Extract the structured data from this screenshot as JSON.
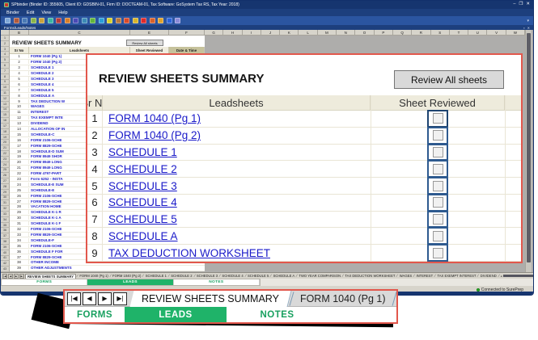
{
  "window": {
    "title": "SPbinder (Binder ID: 355605, Client ID: GDSBIN-01, Firm ID: DOCTEAM-01, Tax Software: GoSystem Tax RS, Tax Year: 2018)",
    "controls": [
      "–",
      "❐",
      "✕"
    ],
    "menu": [
      "Binder",
      "Edit",
      "View",
      "Help"
    ],
    "panel_title": "Forms/Leads/Notes",
    "panel_icons": [
      "▪",
      "✕"
    ],
    "status_text": "Connected to SurePrep"
  },
  "toolbar_icon_colors": [
    "#7ea7d8",
    "#b05a3c",
    "#4a7ab5",
    "#8ab54a",
    "#c8a23c",
    "#3cb5a0",
    "#b53c3c",
    "#d87e2a",
    "#4a4ab5",
    "#3c8ab5",
    "#62b53c",
    "#2a9ed8",
    "#d8d02a",
    "#b5763c",
    "#d84a2a",
    "#d8b42a",
    "#e02a2a",
    "#d8622a",
    "#e0a22a",
    "#2a62d8",
    "#8a8ad8"
  ],
  "spreadsheet": {
    "column_letters": [
      "B",
      "C",
      "E",
      "F",
      "G",
      "H",
      "I",
      "J",
      "K",
      "L",
      "M",
      "N",
      "O",
      "P",
      "Q",
      "R",
      "S",
      "T",
      "U",
      "V",
      "W"
    ],
    "gutter_count": 43,
    "title": "REVIEW SHEETS SUMMARY",
    "review_all_button": "Review All sheets",
    "headers": {
      "sr": "Sr No",
      "lead": "Leadsheets",
      "reviewed": "Sheet Reviewed",
      "datetime": "Date & Time"
    },
    "rows": [
      {
        "no": "1",
        "label": "FORM 1040 (Pg 1)"
      },
      {
        "no": "2",
        "label": "FORM 1040 (Pg 2)"
      },
      {
        "no": "3",
        "label": "SCHEDULE 1"
      },
      {
        "no": "4",
        "label": "SCHEDULE 2"
      },
      {
        "no": "5",
        "label": "SCHEDULE 3"
      },
      {
        "no": "6",
        "label": "SCHEDULE 4"
      },
      {
        "no": "7",
        "label": "SCHEDULE 5"
      },
      {
        "no": "8",
        "label": "SCHEDULE A"
      },
      {
        "no": "9",
        "label": "TAX DEDUCTION W"
      },
      {
        "no": "10",
        "label": "WAGES"
      },
      {
        "no": "11",
        "label": "INTEREST"
      },
      {
        "no": "12",
        "label": "TAX EXEMPT INTE"
      },
      {
        "no": "13",
        "label": "DIVIDEND"
      },
      {
        "no": "14",
        "label": "ALLOCATION OF IN"
      },
      {
        "no": "15",
        "label": "SCHEDULE-C"
      },
      {
        "no": "16",
        "label": "FORM 2106-SCHE"
      },
      {
        "no": "17",
        "label": "FORM 8829-SCHE"
      },
      {
        "no": "18",
        "label": "SCHEDULE-D SUM"
      },
      {
        "no": "19",
        "label": "FORM 8949 SHOR"
      },
      {
        "no": "20",
        "label": "FORM 8949 LONG"
      },
      {
        "no": "21",
        "label": "FORM 8949 LONG"
      },
      {
        "no": "22",
        "label": "FORM 4797-PART"
      },
      {
        "no": "23",
        "label": "Form 6252 - INSTA"
      },
      {
        "no": "24",
        "label": "SCHEDULE-E SUM"
      },
      {
        "no": "25",
        "label": "SCHEDULE-E"
      },
      {
        "no": "26",
        "label": "FORM 2106-SCHE"
      },
      {
        "no": "27",
        "label": "FORM 8829-SCHE"
      },
      {
        "no": "28",
        "label": "VACATION HOME"
      },
      {
        "no": "29",
        "label": "SCHEDULE K-1 R"
      },
      {
        "no": "30",
        "label": "SCHEDULE K-1 A"
      },
      {
        "no": "31",
        "label": "SCHEDULE K-1 F"
      },
      {
        "no": "32",
        "label": "FORM 2106-SCHE"
      },
      {
        "no": "33",
        "label": "FORM 8829-SCHE"
      },
      {
        "no": "34",
        "label": "SCHEDULE-F"
      },
      {
        "no": "35",
        "label": "FORM 2106-SCHE"
      },
      {
        "no": "36",
        "label": "SCHEDULE F FOR"
      },
      {
        "no": "37",
        "label": "FORM 8829-SCHE"
      },
      {
        "no": "38",
        "label": "OTHER INCOME"
      },
      {
        "no": "39",
        "label": "OTHER ADJUSTMENTS"
      }
    ]
  },
  "overlay": {
    "title": "REVIEW SHEETS SUMMARY",
    "review_all_button": "Review All sheets",
    "headers": {
      "sr": "Sr No",
      "lead": "Leadsheets",
      "reviewed": "Sheet Reviewed"
    },
    "rows": [
      {
        "no": "1",
        "label": "FORM 1040 (Pg 1)",
        "checked": false
      },
      {
        "no": "2",
        "label": "FORM 1040 (Pg 2)",
        "checked": false
      },
      {
        "no": "3",
        "label": "SCHEDULE 1",
        "checked": false
      },
      {
        "no": "4",
        "label": "SCHEDULE 2",
        "checked": false
      },
      {
        "no": "5",
        "label": "SCHEDULE 3",
        "checked": false
      },
      {
        "no": "6",
        "label": "SCHEDULE 4",
        "checked": false
      },
      {
        "no": "7",
        "label": "SCHEDULE 5",
        "checked": false
      },
      {
        "no": "8",
        "label": "SCHEDULE A",
        "checked": false
      },
      {
        "no": "9",
        "label": "TAX DEDUCTION WORKSHEET",
        "checked": false
      }
    ]
  },
  "sheet_tabs": {
    "nav_glyphs": [
      "|◀",
      "◀",
      "▶",
      "▶|"
    ],
    "active_index": 0,
    "tabs": [
      "REVIEW SHEETS SUMMARY",
      "FORM 1040 (Pg 1)",
      "FORM 1040 (Pg 2)",
      "SCHEDULE 1",
      "SCHEDULE 2",
      "SCHEDULE 3",
      "SCHEDULE 4",
      "SCHEDULE 5",
      "SCHEDULE A",
      "TWO YEAR COMPARISON",
      "TAX DEDUCTION WORKSHEET",
      "WAGES",
      "INTEREST",
      "TAX EXEMPT INTEREST",
      "DIVIDEND"
    ]
  },
  "mode_tabs": {
    "forms": "FORMS",
    "leads": "LEADS",
    "notes": "NOTES",
    "active": "LEADS"
  },
  "bottom_overlay": {
    "nav_glyphs": [
      "|◀",
      "◀",
      "▶",
      "▶|"
    ],
    "active_tab": "REVIEW SHEETS SUMMARY",
    "next_tab": "FORM 1040 (Pg 1)",
    "forms": "FORMS",
    "leads": "LEADS",
    "notes": "NOTES"
  },
  "colors": {
    "accent_green": "#1fb369",
    "overlay_border": "#e2574c",
    "link_blue": "#1a1ac9",
    "titlebar_navy": "#16356f",
    "status_green": "#27b327"
  }
}
